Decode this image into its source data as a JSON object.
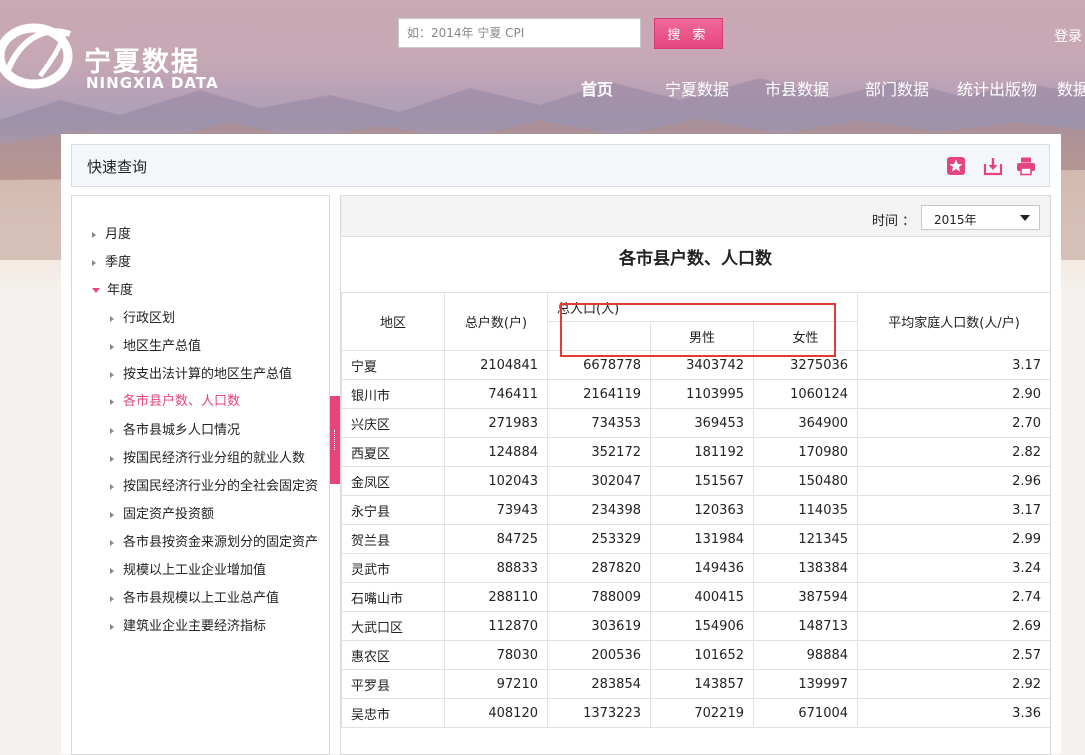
{
  "header": {
    "logo_cn": "宁夏数据",
    "logo_en": "NINGXIA DATA",
    "search_placeholder": "如：2014年 宁夏 CPI",
    "search_button": "搜 索",
    "login": "登录"
  },
  "nav": {
    "items": [
      "首页",
      "宁夏数据",
      "市县数据",
      "部门数据",
      "统计出版物",
      "数据"
    ]
  },
  "quick_query": {
    "title": "快速查询",
    "icons": [
      "star-icon",
      "download-icon",
      "print-icon"
    ]
  },
  "sidebar": {
    "items": [
      {
        "label": "月度",
        "level": 0,
        "expanded": false
      },
      {
        "label": "季度",
        "level": 0,
        "expanded": false
      },
      {
        "label": "年度",
        "level": 0,
        "expanded": true
      },
      {
        "label": "行政区划",
        "level": 1
      },
      {
        "label": "地区生产总值",
        "level": 1
      },
      {
        "label": "按支出法计算的地区生产总值",
        "level": 1
      },
      {
        "label": "各市县户数、人口数",
        "level": 1,
        "active": true
      },
      {
        "label": "各市县城乡人口情况",
        "level": 1
      },
      {
        "label": "按国民经济行业分组的就业人数",
        "level": 1
      },
      {
        "label": "按国民经济行业分的全社会固定资",
        "level": 1
      },
      {
        "label": "固定资产投资额",
        "level": 1
      },
      {
        "label": "各市县按资金来源划分的固定资产",
        "level": 1
      },
      {
        "label": "规模以上工业企业增加值",
        "level": 1
      },
      {
        "label": "各市县规模以上工业总产值",
        "level": 1
      },
      {
        "label": "建筑业企业主要经济指标",
        "level": 1
      }
    ]
  },
  "time": {
    "label": "时间 ：",
    "selected": "2015年"
  },
  "table": {
    "title": "各市县户数、人口数",
    "headers": {
      "region": "地区",
      "households": "总户数(户)",
      "population": "总人口(人)",
      "male": "男性",
      "female": "女性",
      "avg": "平均家庭人口数(人/户)"
    },
    "rows": [
      [
        "宁夏",
        "2104841",
        "6678778",
        "3403742",
        "3275036",
        "3.17"
      ],
      [
        "银川市",
        "746411",
        "2164119",
        "1103995",
        "1060124",
        "2.90"
      ],
      [
        "兴庆区",
        "271983",
        "734353",
        "369453",
        "364900",
        "2.70"
      ],
      [
        "西夏区",
        "124884",
        "352172",
        "181192",
        "170980",
        "2.82"
      ],
      [
        "金凤区",
        "102043",
        "302047",
        "151567",
        "150480",
        "2.96"
      ],
      [
        "永宁县",
        "73943",
        "234398",
        "120363",
        "114035",
        "3.17"
      ],
      [
        "贺兰县",
        "84725",
        "253329",
        "131984",
        "121345",
        "2.99"
      ],
      [
        "灵武市",
        "88833",
        "287820",
        "149436",
        "138384",
        "3.24"
      ],
      [
        "石嘴山市",
        "288110",
        "788009",
        "400415",
        "387594",
        "2.74"
      ],
      [
        "大武口区",
        "112870",
        "303619",
        "154906",
        "148713",
        "2.69"
      ],
      [
        "惠农区",
        "78030",
        "200536",
        "101652",
        "98884",
        "2.57"
      ],
      [
        "平罗县",
        "97210",
        "283854",
        "143857",
        "139997",
        "2.92"
      ],
      [
        "吴忠市",
        "408120",
        "1373223",
        "702219",
        "671004",
        "3.36"
      ]
    ]
  },
  "colors": {
    "accent": "#e5457d",
    "highlight_box": "#e53935"
  }
}
